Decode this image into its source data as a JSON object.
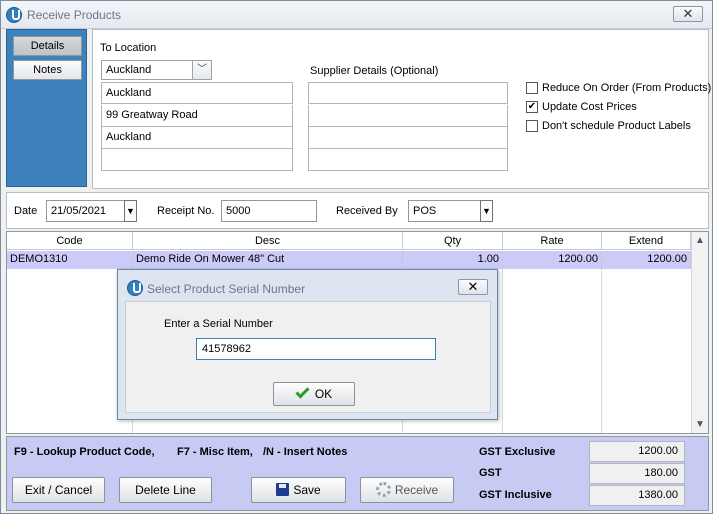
{
  "window": {
    "title": "Receive Products"
  },
  "sidebar": {
    "items": [
      {
        "label": "Details",
        "active": true
      },
      {
        "label": "Notes",
        "active": false
      }
    ]
  },
  "details": {
    "to_location_label": "To Location",
    "location_selected": "Auckland",
    "address_lines": [
      "Auckland",
      "99 Greatway Road",
      "Auckland",
      ""
    ],
    "supplier_label": "Supplier Details (Optional)",
    "supplier_lines": [
      "",
      "",
      "",
      ""
    ],
    "options": [
      {
        "label": "Reduce On Order (From Products)",
        "checked": false
      },
      {
        "label": "Update Cost Prices",
        "checked": true
      },
      {
        "label": "Don't schedule Product Labels",
        "checked": false
      }
    ]
  },
  "datebar": {
    "date_label": "Date",
    "date_value": "21/05/2021",
    "receipt_label": "Receipt No.",
    "receipt_value": "5000",
    "received_by_label": "Received By",
    "received_by_value": "POS"
  },
  "grid": {
    "columns": [
      "Code",
      "Desc",
      "Qty",
      "Rate",
      "Extend"
    ],
    "rows": [
      {
        "code": "DEMO1310",
        "desc": "Demo Ride On Mower 48\" Cut",
        "qty": "1.00",
        "rate": "1200.00",
        "extend": "1200.00"
      }
    ]
  },
  "footer": {
    "hint1": "F9 - Lookup Product Code,",
    "hint2": "F7 - Misc Item,",
    "hint3": "/N - Insert Notes",
    "buttons": {
      "exit": "Exit / Cancel",
      "delete": "Delete Line",
      "save": "Save",
      "receive": "Receive"
    },
    "totals": [
      {
        "label": "GST Exclusive",
        "value": "1200.00"
      },
      {
        "label": "GST",
        "value": "180.00"
      },
      {
        "label": "GST Inclusive",
        "value": "1380.00"
      }
    ]
  },
  "dialog": {
    "title": "Select Product Serial Number",
    "prompt": "Enter a Serial Number",
    "input_value": "41578962",
    "ok_label": "OK"
  },
  "icons": {
    "close": "close-icon",
    "dropdown": "chevron-down-icon",
    "save": "floppy-disk-icon",
    "receive": "gear-icon",
    "ok": "check-icon"
  }
}
